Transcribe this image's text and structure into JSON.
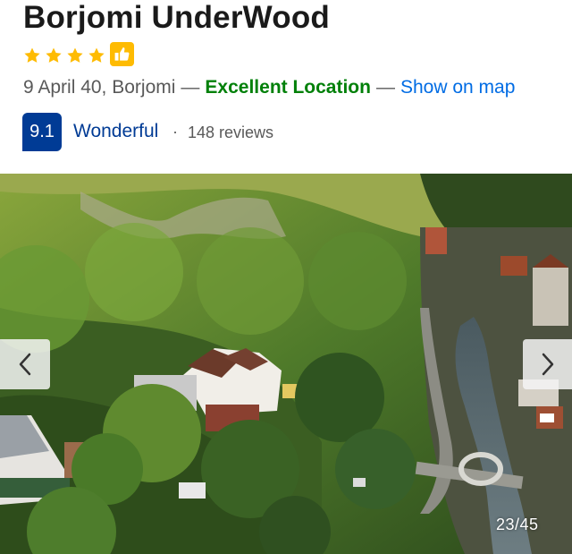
{
  "hotel": {
    "name": "Borjomi UnderWood",
    "star_rating": 4,
    "address": "9 April 40, Borjomi",
    "location_tag": "Excellent Location",
    "map_link": "Show on map",
    "separator": "—"
  },
  "review": {
    "score": "9.1",
    "word": "Wonderful",
    "dot": "·",
    "count": "148 reviews"
  },
  "gallery": {
    "counter": "23/45"
  },
  "colors": {
    "star": "#febb02",
    "score_bg": "#003b95",
    "location_green": "#008009",
    "link_blue": "#006ce4"
  },
  "icons": {
    "star": "star-icon",
    "badge": "thumbs-up-icon",
    "prev": "chevron-left-icon",
    "next": "chevron-right-icon"
  }
}
